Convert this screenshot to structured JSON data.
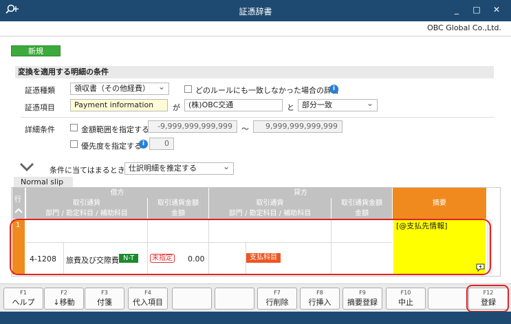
{
  "window": {
    "title": "証憑辞書",
    "app_icon": "search-plus-icon",
    "minimize": "_",
    "maximize": "□",
    "close": "✕"
  },
  "company": "OBC Global Co.,Ltd.",
  "new_button": "新規",
  "conditions": {
    "header": "変換を適用する明細の条件",
    "voucher_type_label": "証憑種類",
    "voucher_type_value": "領収書（その他経費）",
    "unmatched_label": "どのルールにも一致しなかった場合の辞書",
    "voucher_item_label": "証憑項目",
    "voucher_item_value": "Payment information",
    "ga": "が",
    "match_text": "(株)OBC交通",
    "to": "と",
    "match_mode": "部分一致",
    "detail_label": "詳細条件",
    "amount_range_label": "金額範囲を指定する",
    "amount_min": "-9,999,999,999,999",
    "tilde": "～",
    "amount_max": "9,999,999,999,999",
    "priority_label": "優先度を指定する",
    "priority_value": "0"
  },
  "action": {
    "label": "条件に当てはまるとき",
    "value": "仕訳明細を推定する"
  },
  "slip_tab": "Normal slip",
  "grid": {
    "row_header": "行",
    "debit": "借方",
    "credit": "貸方",
    "currency": "取引通貨",
    "currency_amount": "取引通貨金額",
    "account_path": "部門 / 勘定科目 / 補助科目",
    "amount": "金額",
    "memo": "摘要",
    "row_number": "1",
    "dept_code": "4-1208",
    "account": "旅費及び交際費",
    "tax_badge": "N-T",
    "unspecified": "未指定",
    "debit_amount": "0.00",
    "credit_account": "支払科目",
    "memo_text": "[@支払先情報]"
  },
  "fkeys": [
    {
      "key": "F1",
      "label": "ヘルプ"
    },
    {
      "key": "F2",
      "label": "↓移動"
    },
    {
      "key": "F3",
      "label": "付箋"
    },
    {
      "key": "F4",
      "label": "代入項目"
    },
    {
      "key": "",
      "label": ""
    },
    {
      "key": "",
      "label": ""
    },
    {
      "key": "F7",
      "label": "行削除"
    },
    {
      "key": "F8",
      "label": "行挿入"
    },
    {
      "key": "F9",
      "label": "摘要登録"
    },
    {
      "key": "F10",
      "label": "中止"
    },
    {
      "key": "",
      "label": ""
    },
    {
      "key": "F12",
      "label": "登録"
    }
  ]
}
